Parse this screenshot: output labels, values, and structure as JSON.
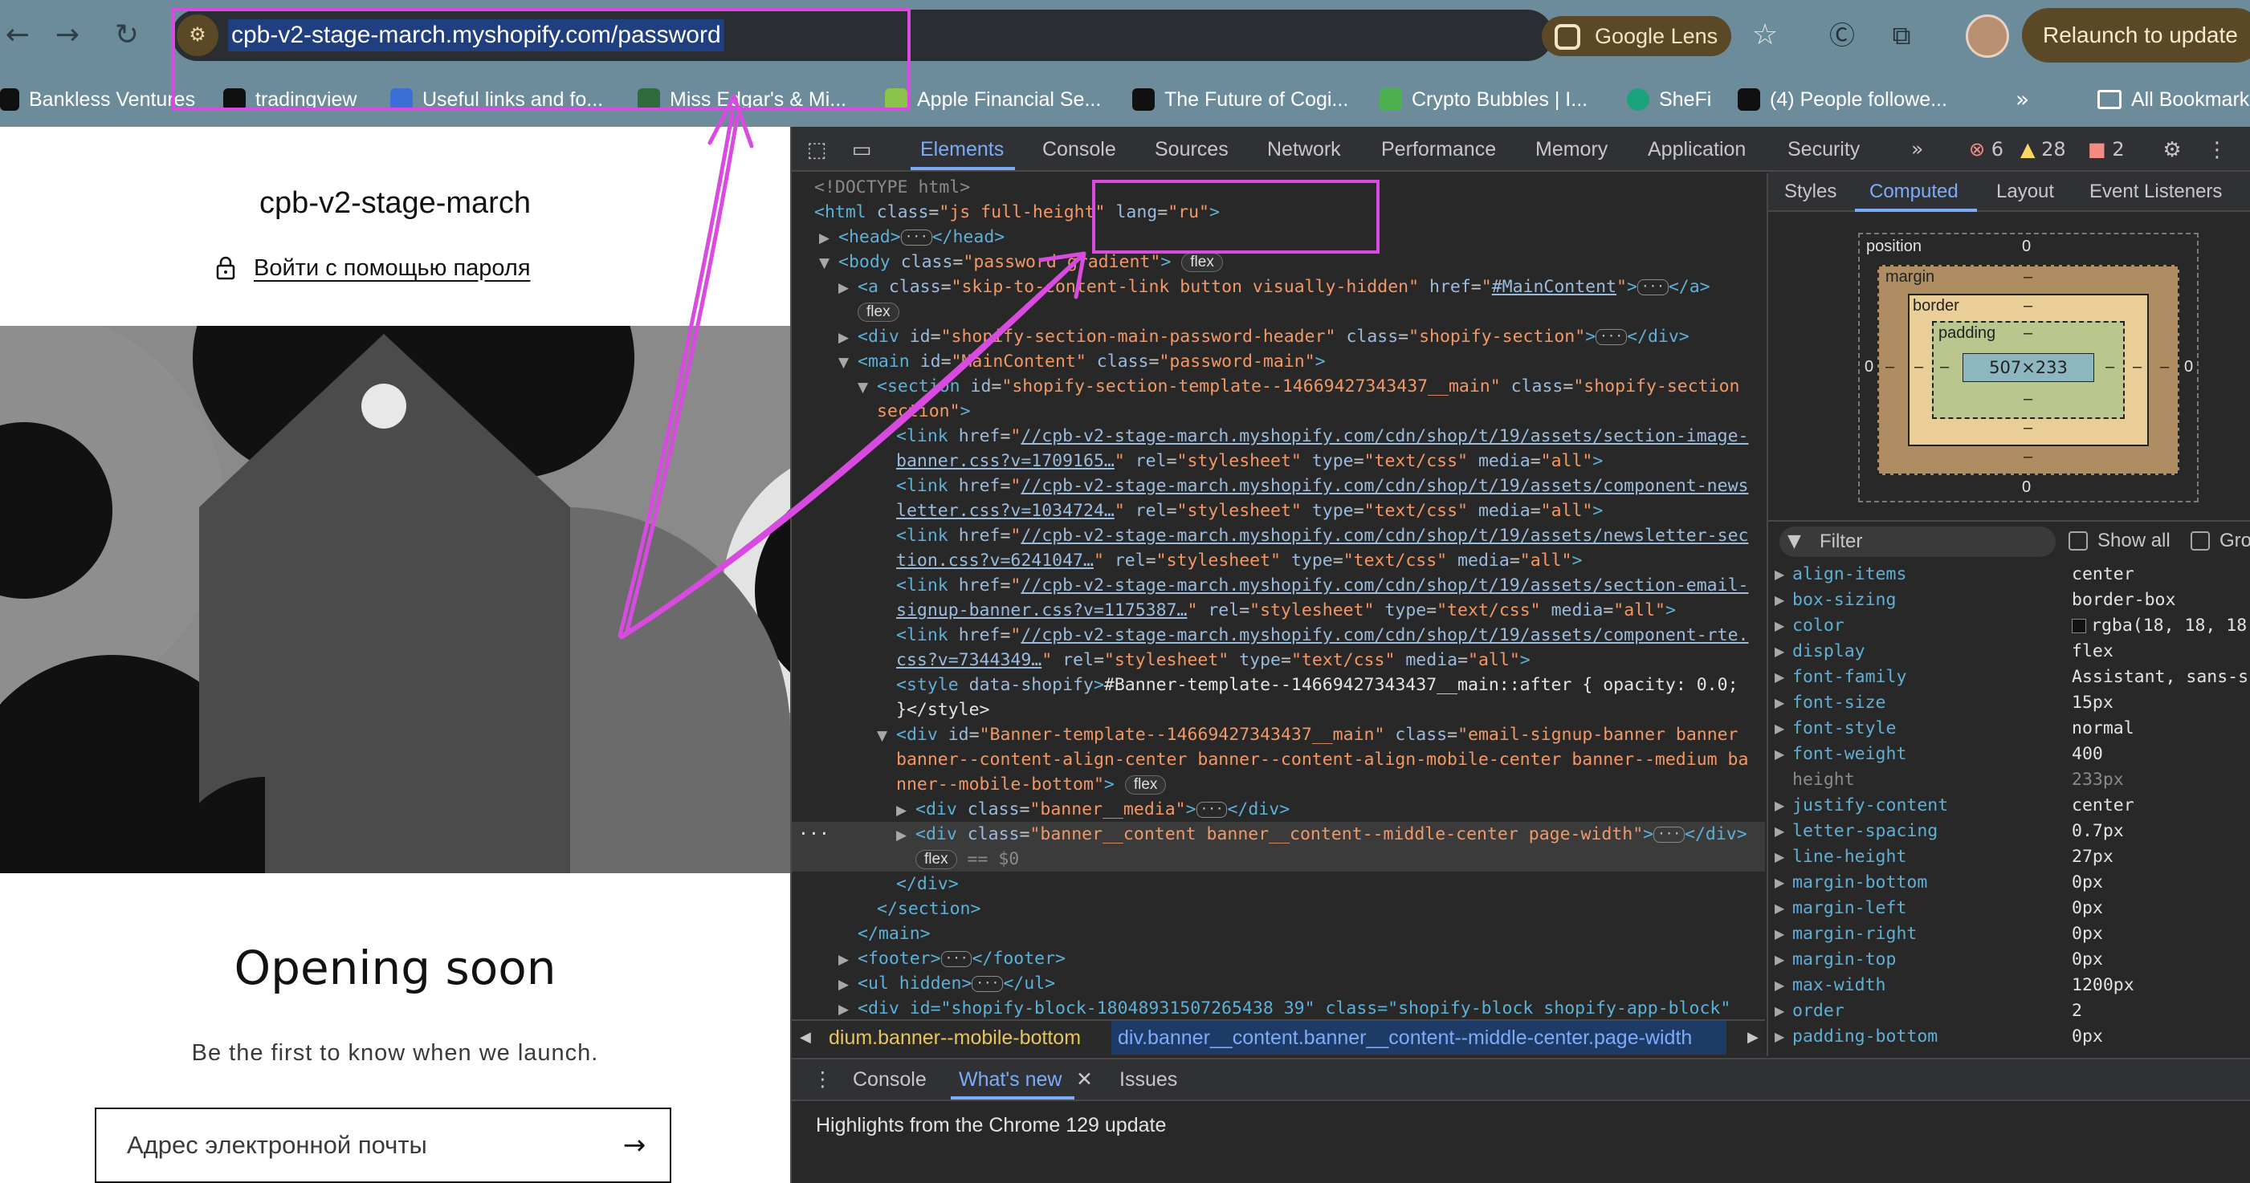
{
  "browser": {
    "url": "cpb-v2-stage-march.myshopify.com/password",
    "google_lens_label": "Google Lens",
    "relaunch_label": "Relaunch to update",
    "bookmarks": [
      {
        "label": "Bankless Ventures",
        "color": "#111111"
      },
      {
        "label": "tradingview",
        "color": "#111111"
      },
      {
        "label": "Useful links and fo...",
        "color": "#3b6fd6"
      },
      {
        "label": "Miss Edgar's & Mi...",
        "color": "#2f6b3d"
      },
      {
        "label": "Apple Financial Se...",
        "color": "#8bc34a"
      },
      {
        "label": "The Future of Cogi...",
        "color": "#111111"
      },
      {
        "label": "Crypto Bubbles | I...",
        "color": "#4caf50"
      },
      {
        "label": "SheFi",
        "color": "#1aa37a"
      },
      {
        "label": "(4) People followe...",
        "color": "#111111"
      }
    ],
    "more_bookmarks_glyph": "»",
    "all_bookmarks_label": "All Bookmarks"
  },
  "page": {
    "store_name": "cpb-v2-stage-march",
    "password_link": "Войти с помощью пароля",
    "headline": "Opening soon",
    "subtext": "Be the first to know when we launch.",
    "email_placeholder": "Адрес электронной почты",
    "submit_glyph": "→"
  },
  "devtools": {
    "tabs": [
      "Elements",
      "Console",
      "Sources",
      "Network",
      "Performance",
      "Memory",
      "Application",
      "Security"
    ],
    "active_tab": "Elements",
    "more_tabs_glyph": "»",
    "errors_count": "6",
    "warnings_count": "28",
    "issues_count": "2",
    "dom": {
      "doctype": "<!DOCTYPE html>",
      "html_open": "html",
      "html_class": "js full-height",
      "html_lang": "ru",
      "head": "head",
      "body_class": "password gradient",
      "skip_link_class": "skip-to-content-link button visually-hidden",
      "skip_link_href": "#MainContent",
      "header_id": "shopify-section-main-password-header",
      "header_class": "shopify-section",
      "main_id": "MainContent",
      "main_class": "password-main",
      "section_id": "shopify-section-template--14669427343437__main",
      "section_class": "shopify-section",
      "section_wrap": "section",
      "links": [
        {
          "href_1": "//cpb-v2-stage-march.myshopify.com/cdn/shop/t/19/assets/section-image-",
          "href_2": "banner.css?v=1709165…"
        },
        {
          "href_1": "//cpb-v2-stage-march.myshopify.com/cdn/shop/t/19/assets/component-news",
          "href_2": "letter.css?v=1034724…"
        },
        {
          "href_1": "//cpb-v2-stage-march.myshopify.com/cdn/shop/t/19/assets/newsletter-sec",
          "href_2": "tion.css?v=6241047…"
        },
        {
          "href_1": "//cpb-v2-stage-march.myshopify.com/cdn/shop/t/19/assets/section-email-",
          "href_2": "signup-banner.css?v=1175387…"
        },
        {
          "href_1": "//cpb-v2-stage-march.myshopify.com/cdn/shop/t/19/assets/component-rte.",
          "href_2": "css?v=7344349…"
        }
      ],
      "style_attr": "data-shopify",
      "style_text": "#Banner-template--14669427343437__main::after { opacity: 0.0;",
      "style_close": "}</style>",
      "banner_id": "Banner-template--14669427343437__main",
      "banner_class_1": "email-signup-banner banner",
      "banner_class_2": "banner--content-align-center banner--content-align-mobile-center banner--medium ba",
      "banner_class_3": "nner--mobile-bottom",
      "media_class": "banner__media",
      "content_class": "banner__content banner__content--middle-center page-width",
      "selected_marker": "== $0",
      "close_div": "</div>",
      "close_section": "</section>",
      "close_main": "</main>",
      "footer": "footer",
      "ul_hidden": "ul hidden",
      "last_line": "<div id=\"shopify-block-18048931507265438 39\" class=\"shopify-block shopify-app-block\""
    },
    "breadcrumbs": {
      "crumb_1": "dium.banner--mobile-bottom",
      "crumb_2_tag": "div",
      "crumb_2_rest": ".banner__content.banner__content--middle-center.page-width"
    },
    "drawer": {
      "tabs": [
        "Console",
        "What's new",
        "Issues"
      ],
      "active": "What's new",
      "content": "Highlights from the Chrome 129 update"
    },
    "side_panel": {
      "tabs": [
        "Styles",
        "Computed",
        "Layout",
        "Event Listeners"
      ],
      "active": "Computed",
      "box_model": {
        "position_label": "position",
        "position_value": "0",
        "margin_label": "margin",
        "margin_value": "–",
        "border_label": "border",
        "border_value": "–",
        "padding_label": "padding",
        "padding_value": "–",
        "content_size": "507×233",
        "outer_bottom": "0",
        "outer_left": "0",
        "outer_right": "0"
      },
      "filter_placeholder": "Filter",
      "show_all_label": "Show all",
      "group_label": "Gro",
      "properties": [
        {
          "name": "align-items",
          "value": "center",
          "inherited": false
        },
        {
          "name": "box-sizing",
          "value": "border-box",
          "inherited": false
        },
        {
          "name": "color",
          "value": "rgba(18, 18, 18",
          "inherited": false,
          "swatch": true
        },
        {
          "name": "display",
          "value": "flex",
          "inherited": false
        },
        {
          "name": "font-family",
          "value": "Assistant, sans-s",
          "inherited": false
        },
        {
          "name": "font-size",
          "value": "15px",
          "inherited": false
        },
        {
          "name": "font-style",
          "value": "normal",
          "inherited": false
        },
        {
          "name": "font-weight",
          "value": "400",
          "inherited": false
        },
        {
          "name": "height",
          "value": "233px",
          "inherited": true
        },
        {
          "name": "justify-content",
          "value": "center",
          "inherited": false
        },
        {
          "name": "letter-spacing",
          "value": "0.7px",
          "inherited": false
        },
        {
          "name": "line-height",
          "value": "27px",
          "inherited": false
        },
        {
          "name": "margin-bottom",
          "value": "0px",
          "inherited": false
        },
        {
          "name": "margin-left",
          "value": "0px",
          "inherited": false
        },
        {
          "name": "margin-right",
          "value": "0px",
          "inherited": false
        },
        {
          "name": "margin-top",
          "value": "0px",
          "inherited": false
        },
        {
          "name": "max-width",
          "value": "1200px",
          "inherited": false
        },
        {
          "name": "order",
          "value": "2",
          "inherited": false
        },
        {
          "name": "padding-bottom",
          "value": "0px",
          "inherited": false
        }
      ]
    }
  },
  "annotation_color": "#d94be0"
}
